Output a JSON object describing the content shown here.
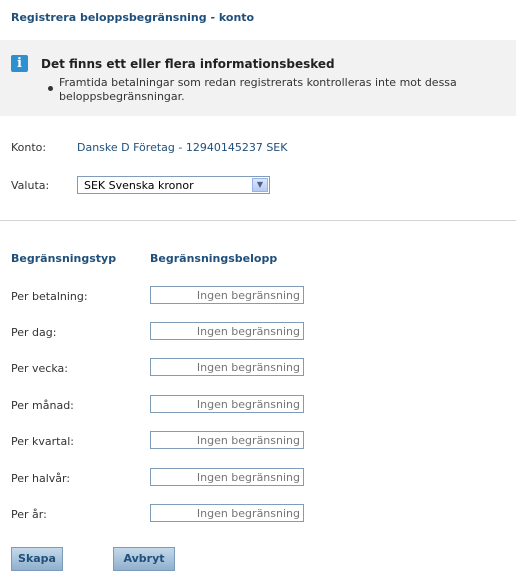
{
  "page_title": "Registrera beloppsbegränsning - konto",
  "info": {
    "icon": "info-icon",
    "heading": "Det finns ett eller flera informationsbesked",
    "message": "Framtida betalningar som redan registrerats kontrolleras inte mot dessa beloppsbegränsningar."
  },
  "account": {
    "label": "Konto:",
    "value": "Danske D Företag - 12940145237 SEK"
  },
  "currency": {
    "label": "Valuta:",
    "selected": "SEK Svenska kronor"
  },
  "limits": {
    "col_type": "Begränsningstyp",
    "col_amount": "Begränsningsbelopp",
    "rows": [
      {
        "label": "Per betalning:",
        "placeholder": "Ingen begränsning"
      },
      {
        "label": "Per dag:",
        "placeholder": "Ingen begränsning"
      },
      {
        "label": "Per vecka:",
        "placeholder": "Ingen begränsning"
      },
      {
        "label": "Per månad:",
        "placeholder": "Ingen begränsning"
      },
      {
        "label": "Per kvartal:",
        "placeholder": "Ingen begränsning"
      },
      {
        "label": "Per halvår:",
        "placeholder": "Ingen begränsning"
      },
      {
        "label": "Per år:",
        "placeholder": "Ingen begränsning"
      }
    ]
  },
  "actions": {
    "create": "Skapa",
    "cancel": "Avbryt"
  }
}
